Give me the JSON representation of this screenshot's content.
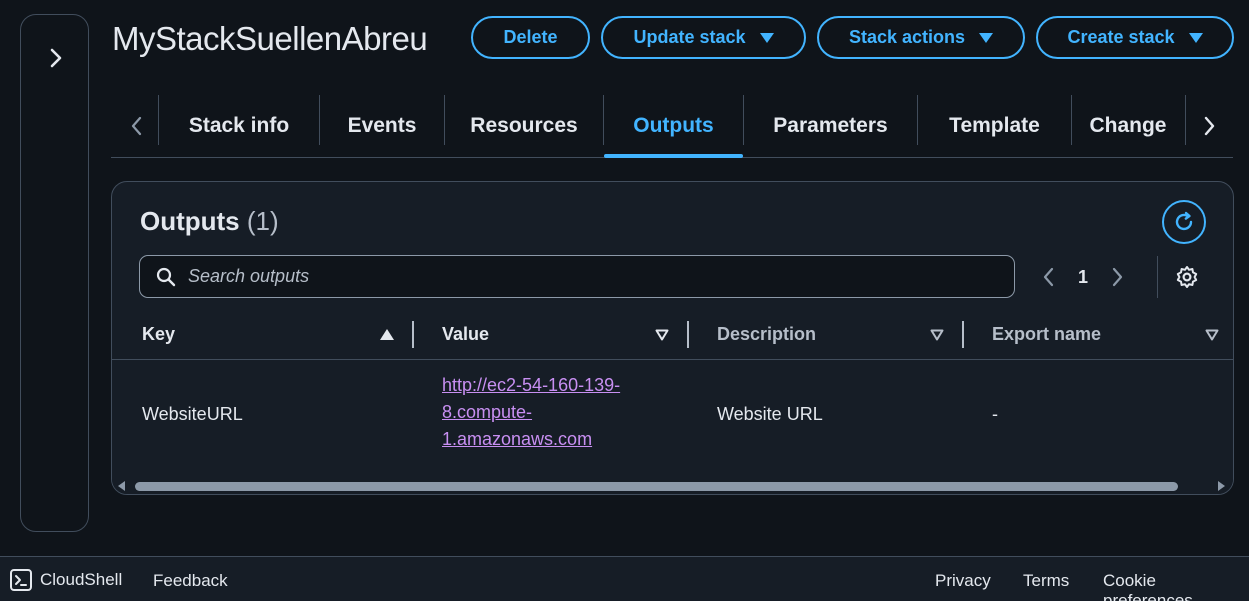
{
  "stack": {
    "title": "MyStackSuellenAbreu"
  },
  "actions": {
    "delete": "Delete",
    "update": "Update stack",
    "stack_actions": "Stack actions",
    "create": "Create stack"
  },
  "tabs": [
    "Stack info",
    "Events",
    "Resources",
    "Outputs",
    "Parameters",
    "Template",
    "Change"
  ],
  "active_tab": "Outputs",
  "outputs": {
    "title": "Outputs",
    "count": "(1)",
    "search_placeholder": "Search outputs",
    "page": "1",
    "columns": {
      "key": "Key",
      "value": "Value",
      "description": "Description",
      "export": "Export name"
    },
    "rows": [
      {
        "key": "WebsiteURL",
        "value_lines": [
          "http://ec2-54-160-139-",
          "8.compute-",
          "1.amazonaws.com"
        ],
        "description": "Website URL",
        "export": "-"
      }
    ]
  },
  "footer": {
    "cloudshell": "CloudShell",
    "feedback": "Feedback",
    "privacy": "Privacy",
    "terms": "Terms",
    "cookie": "Cookie preferences"
  },
  "colors": {
    "accent": "#42b4ff",
    "link_visited": "#c88ff2",
    "background": "#0f141a",
    "panel": "#161d26"
  }
}
